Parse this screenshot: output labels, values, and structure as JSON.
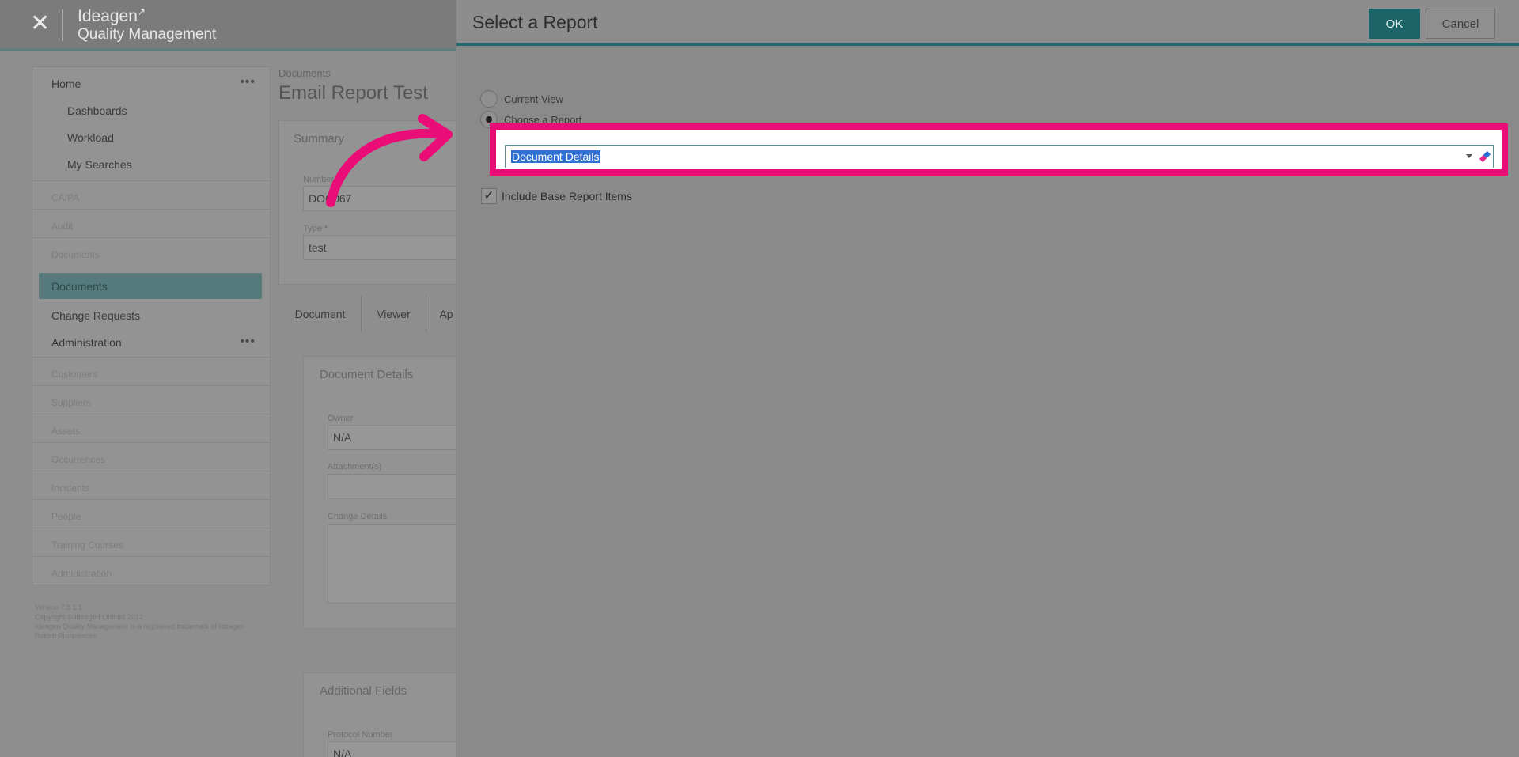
{
  "app": {
    "brand_line1": "Ideagen",
    "brand_line2": "Quality Management"
  },
  "sidebar": {
    "items": [
      {
        "label": "Home",
        "has_menu": true
      },
      {
        "label": "Dashboards"
      },
      {
        "label": "Workload"
      },
      {
        "label": "My Searches"
      },
      {
        "label": "CA/PA"
      },
      {
        "label": "Audit"
      },
      {
        "label": "Documents"
      },
      {
        "label": "Documents",
        "active": true
      },
      {
        "label": "Change Requests"
      },
      {
        "label": "Administration",
        "has_menu": true
      },
      {
        "label": "Customers"
      },
      {
        "label": "Suppliers"
      },
      {
        "label": "Assets"
      },
      {
        "label": "Occurrences"
      },
      {
        "label": "Incidents"
      },
      {
        "label": "People"
      },
      {
        "label": "Training Courses"
      },
      {
        "label": "Administration"
      }
    ],
    "menu_dots": "•••",
    "footer_line1": "Version 7.8.1.1",
    "footer_line2": "Copyright © Ideagen Limited 2022",
    "footer_line3": "Ideagen Quality Management is a registered trademark of Ideagen",
    "footer_line4": "Return Preferences"
  },
  "page": {
    "breadcrumb": "Documents",
    "title": "Email Report Test",
    "summary": {
      "title": "Summary",
      "number_label": "Number",
      "number_value": "DOC067",
      "type_label": "Type *",
      "type_value": "test"
    },
    "tabs": [
      "Document",
      "Viewer",
      "Ap"
    ],
    "details": {
      "title": "Document Details",
      "owner_label": "Owner",
      "owner_value": "N/A",
      "attachments_label": "Attachment(s)",
      "change_details_label": "Change Details"
    },
    "additional": {
      "title": "Additional Fields",
      "protocol_label": "Protocol Number",
      "protocol_value": "N/A"
    }
  },
  "modal": {
    "title": "Select a Report",
    "ok_label": "OK",
    "cancel_label": "Cancel",
    "radio_current_view": "Current View",
    "radio_choose_report": "Choose a Report",
    "selected_option": "current_view_off_choose_report_on",
    "report_value": "Document Details",
    "include_base_label": "Include Base Report Items",
    "include_base_checked": true,
    "check_glyph": "✓"
  },
  "colors": {
    "accent": "#1d6468",
    "annotation": "#ea0c77",
    "selection": "#2f6fd3"
  }
}
